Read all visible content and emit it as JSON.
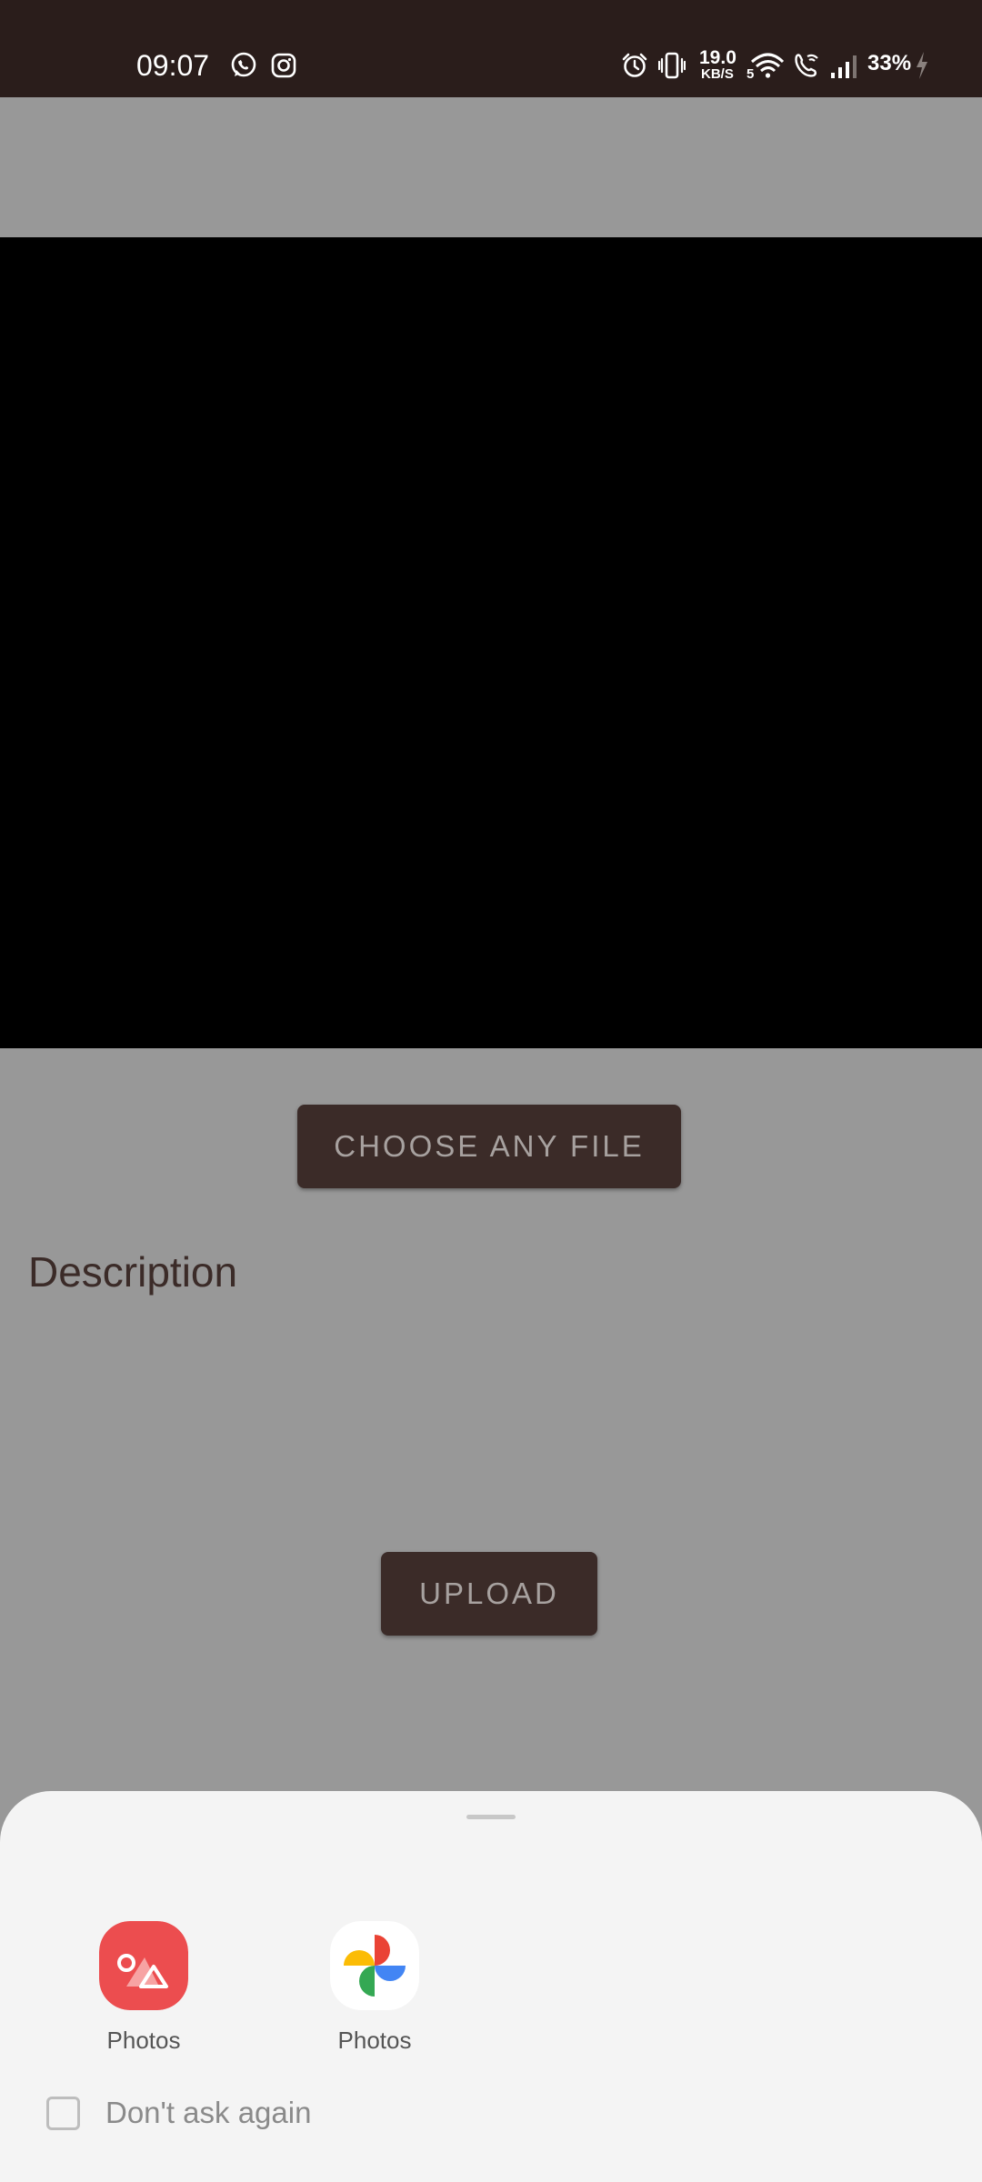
{
  "status_bar": {
    "time": "09:07",
    "net_speed_value": "19.0",
    "net_speed_unit": "KB/S",
    "battery": "33%",
    "icons": [
      "whatsapp-icon",
      "instagram-icon",
      "alarm-icon",
      "vibrate-icon",
      "wifi-icon",
      "wifi-calling-icon",
      "signal-icon",
      "charging-icon"
    ]
  },
  "main": {
    "choose_button": "CHOOSE ANY FILE",
    "description_label": "Description",
    "upload_button": "UPLOAD"
  },
  "chooser": {
    "apps": [
      {
        "label": "Photos",
        "icon": "samsung-gallery-icon"
      },
      {
        "label": "Photos",
        "icon": "google-photos-icon"
      }
    ],
    "dont_ask_label": "Don't ask again"
  },
  "colors": {
    "status_bar": "#2a1d1b",
    "button": "#3b2b28",
    "scrim_background": "#989898",
    "sheet": "#f4f4f4"
  }
}
